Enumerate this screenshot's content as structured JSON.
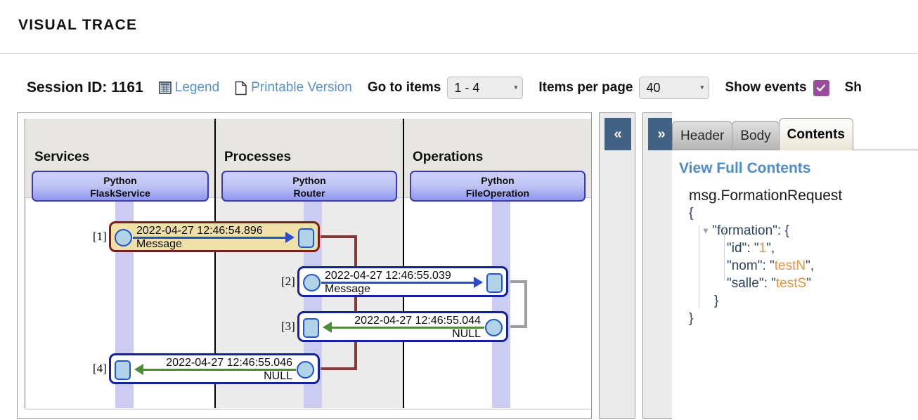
{
  "app": {
    "title": "VISUAL TRACE"
  },
  "toolbar": {
    "session_label": "Session ID: 1161",
    "legend_label": "Legend",
    "legend_icon": "table-grid-icon",
    "printable_label": "Printable Version",
    "printable_icon": "page-document-icon",
    "go_to_items_label": "Go to items",
    "go_to_items_value": "1 - 4",
    "items_per_page_label": "Items per page",
    "items_per_page_value": "40",
    "show_events_label": "Show events",
    "show_events_checked": true,
    "show_events_color": "#9a4d9e",
    "truncated_label": "Sh",
    "link_color": "#5b8fc7"
  },
  "diagram": {
    "lanes": [
      {
        "title": "Services",
        "actor_line1": "Python",
        "actor_line2": "FlaskService"
      },
      {
        "title": "Processes",
        "actor_line1": "Python",
        "actor_line2": "Router"
      },
      {
        "title": "Operations",
        "actor_line1": "Python",
        "actor_line2": "FileOperation"
      }
    ],
    "messages": [
      {
        "index": "[1]",
        "time": "2022-04-27 12:46:54.896",
        "sub": "Message",
        "direction": "request",
        "selected": true
      },
      {
        "index": "[2]",
        "time": "2022-04-27 12:46:55.039",
        "sub": "Message",
        "direction": "request",
        "selected": false
      },
      {
        "index": "[3]",
        "time": "2022-04-27 12:46:55.044",
        "sub": "NULL",
        "direction": "return",
        "selected": false
      },
      {
        "index": "[4]",
        "time": "2022-04-27 12:46:55.046",
        "sub": "NULL",
        "direction": "return",
        "selected": false
      }
    ],
    "colors": {
      "request_arrow": "#2e4cc4",
      "return_arrow": "#4a8f36",
      "selected_fill": "#f0e0a8",
      "selected_border": "#7d1d1d",
      "row_border": "#14239c",
      "lifeline": "#ccccf2",
      "connector_red": "#8b3a3a",
      "connector_gray": "#9e9e9e"
    }
  },
  "collapse": {
    "left_label": "«",
    "right_label": "»"
  },
  "details": {
    "tabs": [
      {
        "label": "Header",
        "active": false
      },
      {
        "label": "Body",
        "active": false
      },
      {
        "label": "Contents",
        "active": true
      }
    ],
    "view_full_label": "View Full Contents",
    "json_title": "msg.FormationRequest",
    "json_lines": [
      {
        "text": "{",
        "indent": 0,
        "toggle": false
      },
      {
        "text": "\"formation\": {",
        "indent": 1,
        "toggle": true
      },
      {
        "text": "\"id\": \"1\",",
        "indent": 3,
        "toggle": false
      },
      {
        "text": "\"nom\": \"testN\",",
        "indent": 3,
        "toggle": false
      },
      {
        "text": "\"salle\": \"testS\"",
        "indent": 3,
        "toggle": false
      },
      {
        "text": "}",
        "indent": 2,
        "toggle": false
      },
      {
        "text": "}",
        "indent": 0,
        "toggle": false
      }
    ]
  }
}
